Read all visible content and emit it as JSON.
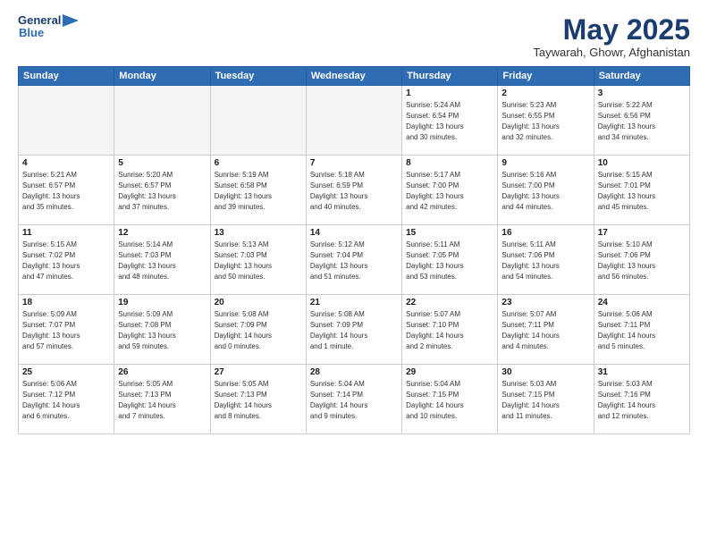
{
  "header": {
    "logo_line1": "General",
    "logo_line2": "Blue",
    "main_title": "May 2025",
    "subtitle": "Taywarah, Ghowr, Afghanistan"
  },
  "days_of_week": [
    "Sunday",
    "Monday",
    "Tuesday",
    "Wednesday",
    "Thursday",
    "Friday",
    "Saturday"
  ],
  "weeks": [
    {
      "days": [
        {
          "num": "",
          "info": "",
          "empty": true
        },
        {
          "num": "",
          "info": "",
          "empty": true
        },
        {
          "num": "",
          "info": "",
          "empty": true
        },
        {
          "num": "",
          "info": "",
          "empty": true
        },
        {
          "num": "1",
          "info": "Sunrise: 5:24 AM\nSunset: 6:54 PM\nDaylight: 13 hours\nand 30 minutes.",
          "empty": false
        },
        {
          "num": "2",
          "info": "Sunrise: 5:23 AM\nSunset: 6:55 PM\nDaylight: 13 hours\nand 32 minutes.",
          "empty": false
        },
        {
          "num": "3",
          "info": "Sunrise: 5:22 AM\nSunset: 6:56 PM\nDaylight: 13 hours\nand 34 minutes.",
          "empty": false
        }
      ]
    },
    {
      "days": [
        {
          "num": "4",
          "info": "Sunrise: 5:21 AM\nSunset: 6:57 PM\nDaylight: 13 hours\nand 35 minutes.",
          "empty": false
        },
        {
          "num": "5",
          "info": "Sunrise: 5:20 AM\nSunset: 6:57 PM\nDaylight: 13 hours\nand 37 minutes.",
          "empty": false
        },
        {
          "num": "6",
          "info": "Sunrise: 5:19 AM\nSunset: 6:58 PM\nDaylight: 13 hours\nand 39 minutes.",
          "empty": false
        },
        {
          "num": "7",
          "info": "Sunrise: 5:18 AM\nSunset: 6:59 PM\nDaylight: 13 hours\nand 40 minutes.",
          "empty": false
        },
        {
          "num": "8",
          "info": "Sunrise: 5:17 AM\nSunset: 7:00 PM\nDaylight: 13 hours\nand 42 minutes.",
          "empty": false
        },
        {
          "num": "9",
          "info": "Sunrise: 5:16 AM\nSunset: 7:00 PM\nDaylight: 13 hours\nand 44 minutes.",
          "empty": false
        },
        {
          "num": "10",
          "info": "Sunrise: 5:15 AM\nSunset: 7:01 PM\nDaylight: 13 hours\nand 45 minutes.",
          "empty": false
        }
      ]
    },
    {
      "days": [
        {
          "num": "11",
          "info": "Sunrise: 5:15 AM\nSunset: 7:02 PM\nDaylight: 13 hours\nand 47 minutes.",
          "empty": false
        },
        {
          "num": "12",
          "info": "Sunrise: 5:14 AM\nSunset: 7:03 PM\nDaylight: 13 hours\nand 48 minutes.",
          "empty": false
        },
        {
          "num": "13",
          "info": "Sunrise: 5:13 AM\nSunset: 7:03 PM\nDaylight: 13 hours\nand 50 minutes.",
          "empty": false
        },
        {
          "num": "14",
          "info": "Sunrise: 5:12 AM\nSunset: 7:04 PM\nDaylight: 13 hours\nand 51 minutes.",
          "empty": false
        },
        {
          "num": "15",
          "info": "Sunrise: 5:11 AM\nSunset: 7:05 PM\nDaylight: 13 hours\nand 53 minutes.",
          "empty": false
        },
        {
          "num": "16",
          "info": "Sunrise: 5:11 AM\nSunset: 7:06 PM\nDaylight: 13 hours\nand 54 minutes.",
          "empty": false
        },
        {
          "num": "17",
          "info": "Sunrise: 5:10 AM\nSunset: 7:06 PM\nDaylight: 13 hours\nand 56 minutes.",
          "empty": false
        }
      ]
    },
    {
      "days": [
        {
          "num": "18",
          "info": "Sunrise: 5:09 AM\nSunset: 7:07 PM\nDaylight: 13 hours\nand 57 minutes.",
          "empty": false
        },
        {
          "num": "19",
          "info": "Sunrise: 5:09 AM\nSunset: 7:08 PM\nDaylight: 13 hours\nand 59 minutes.",
          "empty": false
        },
        {
          "num": "20",
          "info": "Sunrise: 5:08 AM\nSunset: 7:09 PM\nDaylight: 14 hours\nand 0 minutes.",
          "empty": false
        },
        {
          "num": "21",
          "info": "Sunrise: 5:08 AM\nSunset: 7:09 PM\nDaylight: 14 hours\nand 1 minute.",
          "empty": false
        },
        {
          "num": "22",
          "info": "Sunrise: 5:07 AM\nSunset: 7:10 PM\nDaylight: 14 hours\nand 2 minutes.",
          "empty": false
        },
        {
          "num": "23",
          "info": "Sunrise: 5:07 AM\nSunset: 7:11 PM\nDaylight: 14 hours\nand 4 minutes.",
          "empty": false
        },
        {
          "num": "24",
          "info": "Sunrise: 5:06 AM\nSunset: 7:11 PM\nDaylight: 14 hours\nand 5 minutes.",
          "empty": false
        }
      ]
    },
    {
      "days": [
        {
          "num": "25",
          "info": "Sunrise: 5:06 AM\nSunset: 7:12 PM\nDaylight: 14 hours\nand 6 minutes.",
          "empty": false
        },
        {
          "num": "26",
          "info": "Sunrise: 5:05 AM\nSunset: 7:13 PM\nDaylight: 14 hours\nand 7 minutes.",
          "empty": false
        },
        {
          "num": "27",
          "info": "Sunrise: 5:05 AM\nSunset: 7:13 PM\nDaylight: 14 hours\nand 8 minutes.",
          "empty": false
        },
        {
          "num": "28",
          "info": "Sunrise: 5:04 AM\nSunset: 7:14 PM\nDaylight: 14 hours\nand 9 minutes.",
          "empty": false
        },
        {
          "num": "29",
          "info": "Sunrise: 5:04 AM\nSunset: 7:15 PM\nDaylight: 14 hours\nand 10 minutes.",
          "empty": false
        },
        {
          "num": "30",
          "info": "Sunrise: 5:03 AM\nSunset: 7:15 PM\nDaylight: 14 hours\nand 11 minutes.",
          "empty": false
        },
        {
          "num": "31",
          "info": "Sunrise: 5:03 AM\nSunset: 7:16 PM\nDaylight: 14 hours\nand 12 minutes.",
          "empty": false
        }
      ]
    }
  ]
}
